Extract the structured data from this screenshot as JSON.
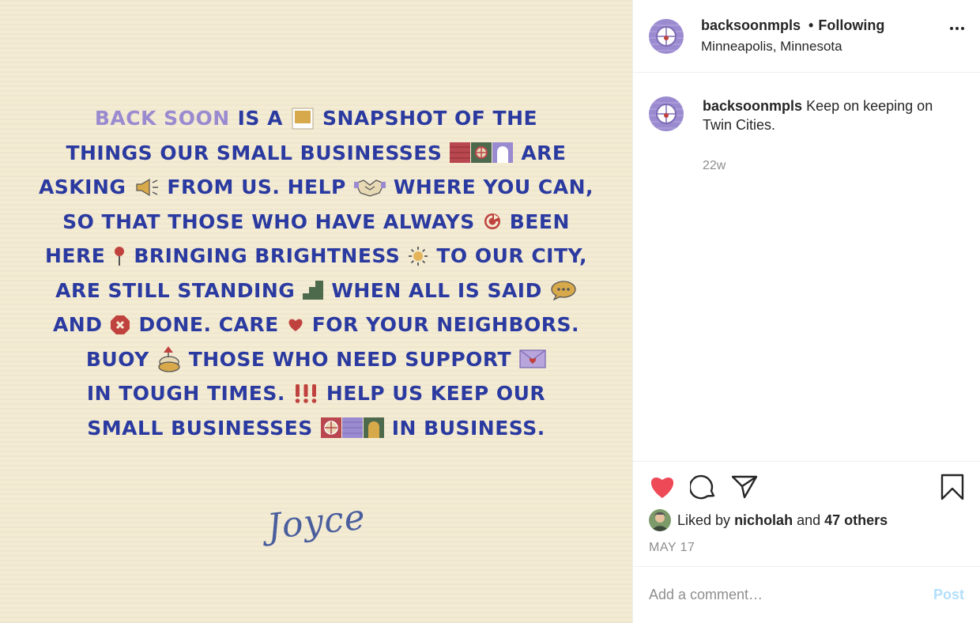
{
  "colors": {
    "image_bg": "#f4ebd3",
    "text_blue": "#2a3aa0",
    "highlight_purple": "#9a8ad0",
    "like_red": "#ed4956",
    "post_btn_disabled": "#b2dffc"
  },
  "image": {
    "lines": [
      [
        "BACK SOON",
        "IS A",
        "SNAPSHOT OF THE"
      ],
      [
        "THINGS OUR SMALL BUSINESSES",
        "ARE"
      ],
      [
        "ASKING",
        "FROM US. HELP",
        "WHERE YOU CAN,"
      ],
      [
        "SO THAT THOSE WHO HAVE ALWAYS",
        "BEEN"
      ],
      [
        "HERE",
        "BRINGING BRIGHTNESS",
        "TO OUR CITY,"
      ],
      [
        "ARE STILL STANDING",
        "WHEN ALL IS SAID"
      ],
      [
        "AND",
        "DONE. CARE",
        "FOR YOUR NEIGHBORS."
      ],
      [
        "BUOY",
        "THOSE  WHO NEED SUPPORT"
      ],
      [
        "IN TOUGH TIMES.",
        "HELP US KEEP OUR"
      ],
      [
        "SMALL BUSINESSES",
        "IN  BUSINESS."
      ]
    ],
    "signature": "Joyce",
    "icons": [
      "polaroid-icon",
      "storefront-icon",
      "megaphone-icon",
      "handshake-icon",
      "refresh-icon",
      "pin-icon",
      "sun-icon",
      "stairs-icon",
      "speech-bubble-icon",
      "stop-sign-icon",
      "heart-icon",
      "buoy-icon",
      "envelope-icon",
      "exclamation-icon",
      "storefront-icon"
    ]
  },
  "header": {
    "username": "backsoonmpls",
    "separator": "•",
    "follow_status": "Following",
    "location": "Minneapolis, Minnesota"
  },
  "caption": {
    "username": "backsoonmpls",
    "text": "Keep on keeping on Twin Cities.",
    "time": "22w"
  },
  "actions": {
    "liked_by_prefix": "Liked by",
    "liked_by_user": "nicholah",
    "and": "and",
    "others": "47 others",
    "date": "MAY 17"
  },
  "comment_box": {
    "placeholder": "Add a comment…",
    "post_label": "Post"
  }
}
